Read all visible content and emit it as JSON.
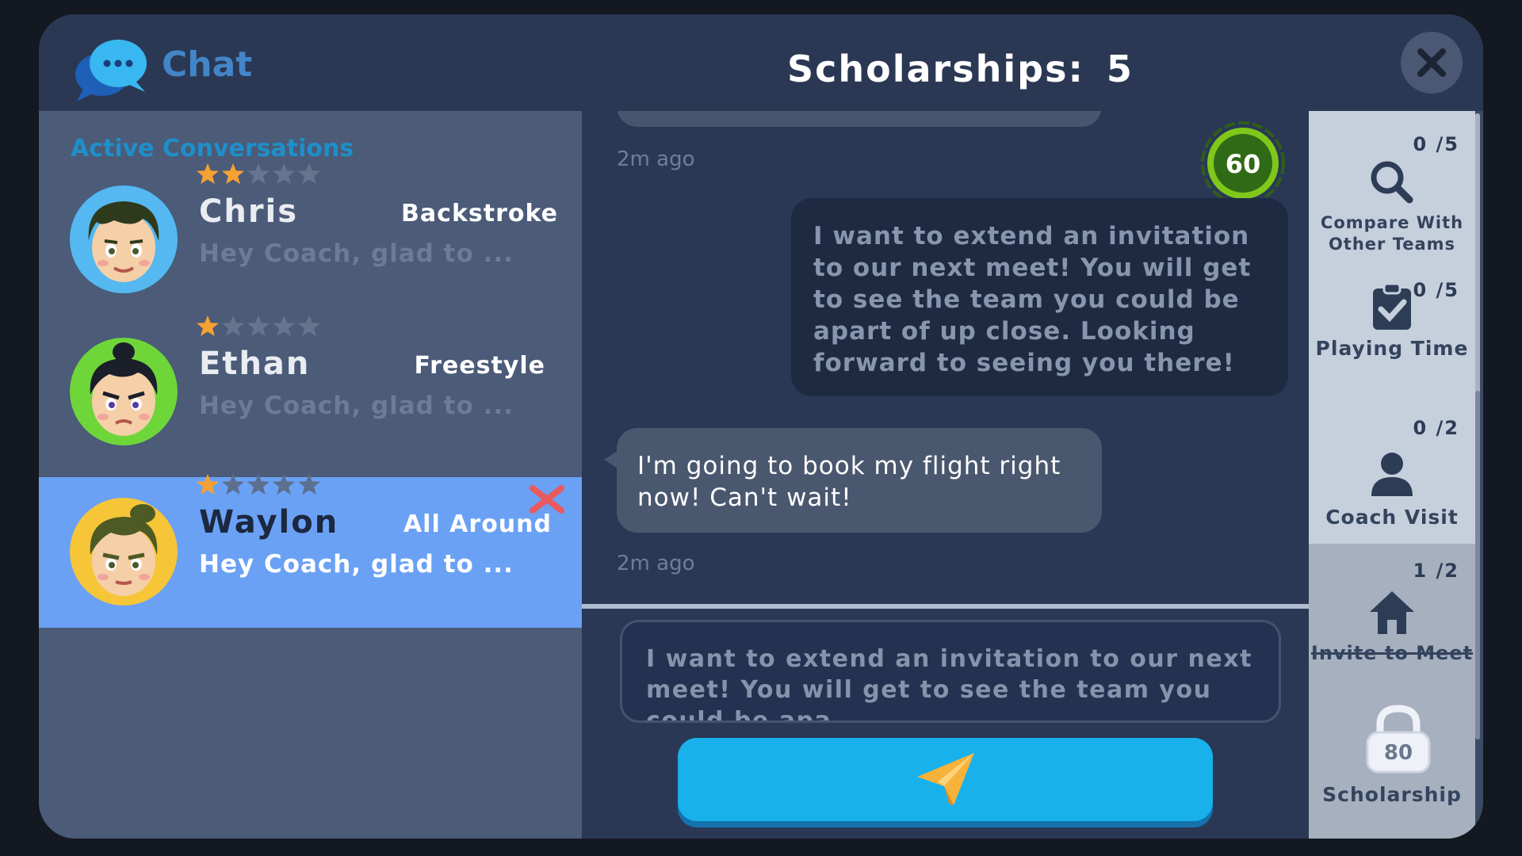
{
  "header": {
    "chat_label": "Chat",
    "scholarships_label": "Scholarships:",
    "scholarships_value": "5"
  },
  "conversations": {
    "title": "Active Conversations",
    "items": [
      {
        "name": "Chris",
        "event": "Backstroke",
        "preview": "Hey Coach, glad to ...",
        "stars": 2,
        "max_stars": 5,
        "selected": false
      },
      {
        "name": "Ethan",
        "event": "Freestyle",
        "preview": "Hey Coach, glad to ...",
        "stars": 1,
        "max_stars": 5,
        "selected": false
      },
      {
        "name": "Waylon",
        "event": "All Around",
        "preview": "Hey Coach, glad to ...",
        "stars": 1,
        "max_stars": 5,
        "selected": true
      }
    ]
  },
  "chat": {
    "timer_value": "60",
    "messages": [
      {
        "from": "recruit",
        "text": "",
        "time": "2m ago"
      },
      {
        "from": "coach",
        "text": "I want to extend an invitation to our next meet! You will get to see the team you could be apart of up close. Looking forward to seeing you there!"
      },
      {
        "from": "recruit",
        "text": "I'm going to book my flight right now! Can't wait!",
        "time": "2m ago"
      }
    ],
    "input_text": "I want to extend an invitation to our next meet! You will get to see the team you could be apa…"
  },
  "actions": [
    {
      "label": "Compare With Other Teams",
      "count": "0 /5",
      "icon": "magnifier-icon"
    },
    {
      "label": "Playing Time",
      "count": "0 /5",
      "icon": "clipboard-check-icon"
    },
    {
      "label": "Coach Visit",
      "count": "0 /2",
      "icon": "person-icon"
    },
    {
      "label": "Invite to Meet",
      "count": "1 /2",
      "icon": "house-icon",
      "used": true
    },
    {
      "label": "Scholarship",
      "count": "",
      "icon": "padlock-icon",
      "lock_value": "80"
    }
  ],
  "colors": {
    "accent": "#1f8fc9",
    "selected_row": "#6aa1f5",
    "send_button": "#18b1ec",
    "star_filled": "#f6a133",
    "timer_green": "#7fc81a"
  }
}
